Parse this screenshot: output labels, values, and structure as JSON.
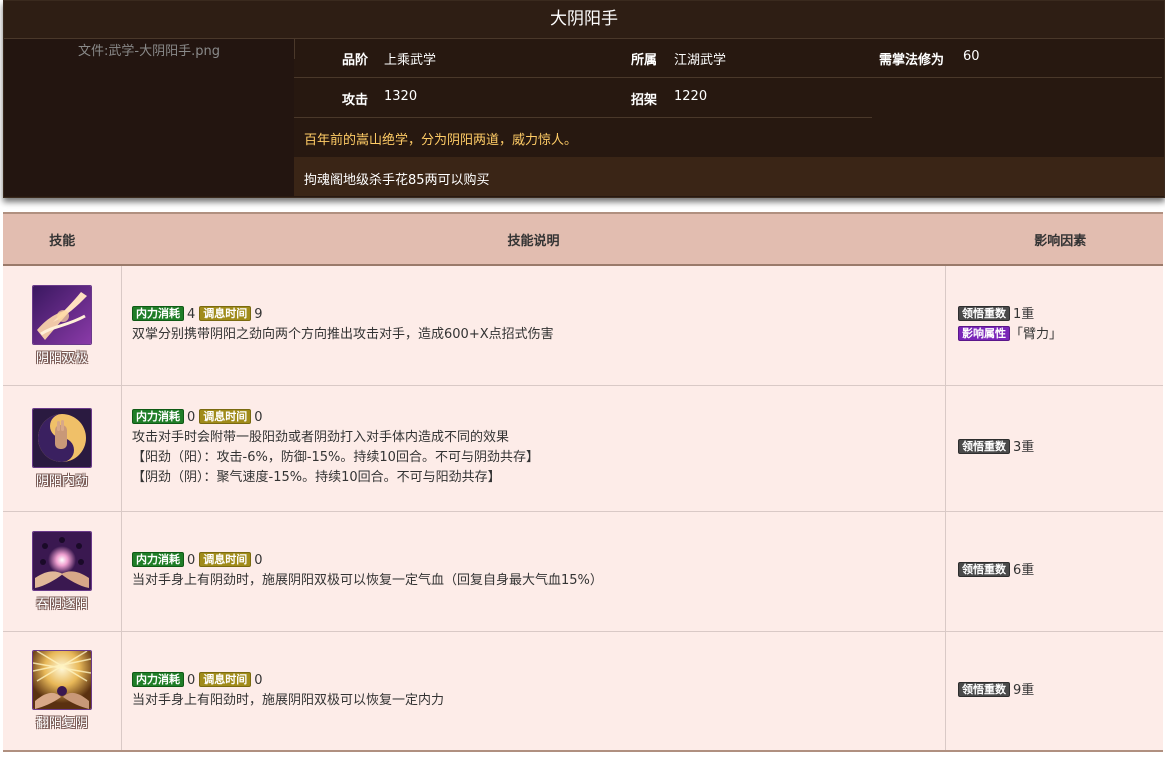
{
  "title": "大阴阳手",
  "image_caption": "文件:武学-大阴阳手.png",
  "info": {
    "rank_label": "品阶",
    "rank_value": "上乘武学",
    "belong_label": "所属",
    "belong_value": "江湖武学",
    "req_label": "需掌法修为",
    "req_value": "60",
    "attack_label": "攻击",
    "attack_value": "1320",
    "parry_label": "招架",
    "parry_value": "1220",
    "description": "百年前的嵩山绝学，分为阴阳两道，威力惊人。",
    "acquire": "拘魂阁地级杀手花85两可以购买"
  },
  "table": {
    "headers": [
      "技能",
      "技能说明",
      "影响因素"
    ]
  },
  "labels": {
    "mp": "内力消耗",
    "cd": "调息时间",
    "realm": "领悟重数",
    "attr": "影响属性"
  },
  "skills": [
    {
      "name": "阴阳双极",
      "icon": "twin-palms-icon",
      "mp": "4",
      "cd": "9",
      "desc": [
        "双掌分别携带阴阳之劲向两个方向推出攻击对手，造成600+X点招式伤害"
      ],
      "realm": "1重",
      "attr": "「臂力」"
    },
    {
      "name": "阴阳内劲",
      "icon": "yin-yang-hand-icon",
      "mp": "0",
      "cd": "0",
      "desc": [
        "攻击对手时会附带一股阳劲或者阴劲打入对手体内造成不同的效果",
        "【阳劲（阳）：攻击-6%，防御-15%。持续10回合。不可与阴劲共存】",
        "【阴劲（阴）：聚气速度-15%。持续10回合。不可与阳劲共存】"
      ],
      "realm": "3重"
    },
    {
      "name": "吞阴逐阳",
      "icon": "orb-hands-icon",
      "mp": "0",
      "cd": "0",
      "desc": [
        "当对手身上有阴劲时，施展阴阳双极可以恢复一定气血（回复自身最大气血15%）"
      ],
      "realm": "6重"
    },
    {
      "name": "翻阳复阴",
      "icon": "radiant-hands-icon",
      "mp": "0",
      "cd": "0",
      "desc": [
        "当对手身上有阳劲时，施展阴阳双极可以恢复一定内力"
      ],
      "realm": "9重"
    }
  ]
}
